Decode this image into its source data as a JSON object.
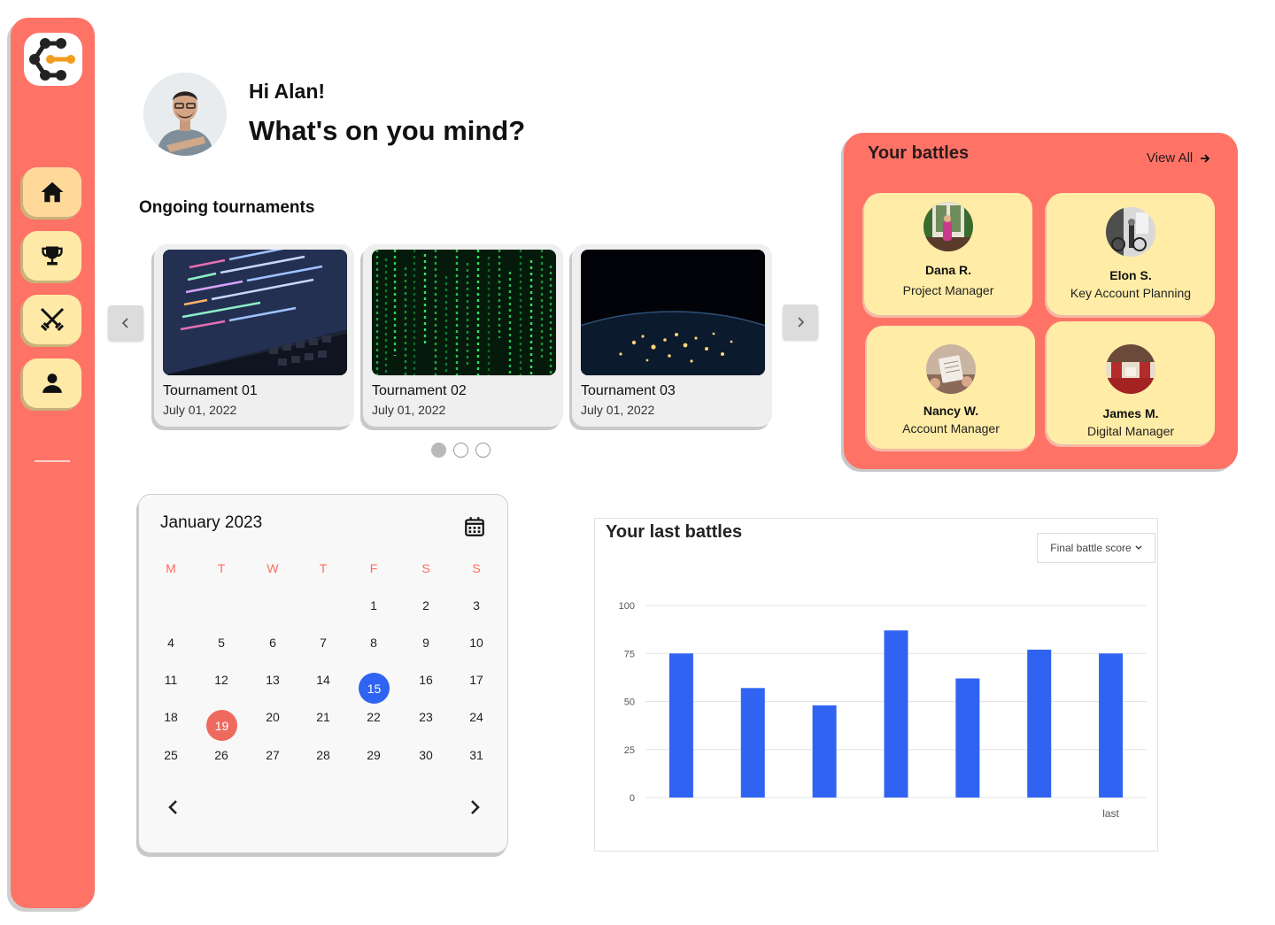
{
  "greeting": {
    "hi": "Hi Alan!",
    "question": "What's on you mind?"
  },
  "sidebar": {
    "items": [
      {
        "name": "home",
        "icon": "home-icon"
      },
      {
        "name": "tournaments",
        "icon": "trophy-icon"
      },
      {
        "name": "battles",
        "icon": "crossed-swords-icon"
      },
      {
        "name": "profile",
        "icon": "user-icon"
      }
    ]
  },
  "tournaments": {
    "title": "Ongoing tournaments",
    "items": [
      {
        "name": "Tournament 01",
        "date": "July 01, 2022"
      },
      {
        "name": "Tournament 02",
        "date": "July 01, 2022"
      },
      {
        "name": "Tournament 03",
        "date": "July 01, 2022"
      }
    ],
    "active_page": 1,
    "page_count": 3
  },
  "battles": {
    "title": "Your battles",
    "view_all": "View All",
    "people": [
      {
        "name": "Dana R.",
        "role": "Project Manager"
      },
      {
        "name": "Elon S.",
        "role": "Key Account Planning"
      },
      {
        "name": "Nancy W.",
        "role": "Account Manager"
      },
      {
        "name": "James M.",
        "role": "Digital Manager"
      }
    ]
  },
  "calendar": {
    "title": "January 2023",
    "weekdays": [
      "M",
      "T",
      "W",
      "T",
      "F",
      "S",
      "S"
    ],
    "weeks": [
      [
        "",
        "",
        "",
        "",
        "1",
        "2",
        "3"
      ],
      [
        "4",
        "5",
        "6",
        "7",
        "8",
        "9",
        "10"
      ],
      [
        "11",
        "12",
        "13",
        "14",
        "15",
        "16",
        "17"
      ],
      [
        "18",
        "19",
        "20",
        "21",
        "22",
        "23",
        "24"
      ],
      [
        "25",
        "26",
        "27",
        "28",
        "29",
        "30",
        "31"
      ]
    ],
    "selected_day": "15",
    "highlighted_day": "19",
    "colors": {
      "selected": "#2f64f2",
      "highlighted": "#ef6a5e"
    }
  },
  "last_battles": {
    "title": "Your last battles",
    "dropdown": "Final battle score"
  },
  "chart_data": {
    "type": "bar",
    "categories": [
      "",
      "",
      "",
      "",
      "",
      "",
      "last"
    ],
    "values": [
      75,
      57,
      48,
      87,
      62,
      77,
      75
    ],
    "yticks": [
      0,
      25,
      50,
      75,
      100
    ],
    "ylim": [
      0,
      100
    ],
    "grid": true,
    "color": "#3163f2"
  }
}
